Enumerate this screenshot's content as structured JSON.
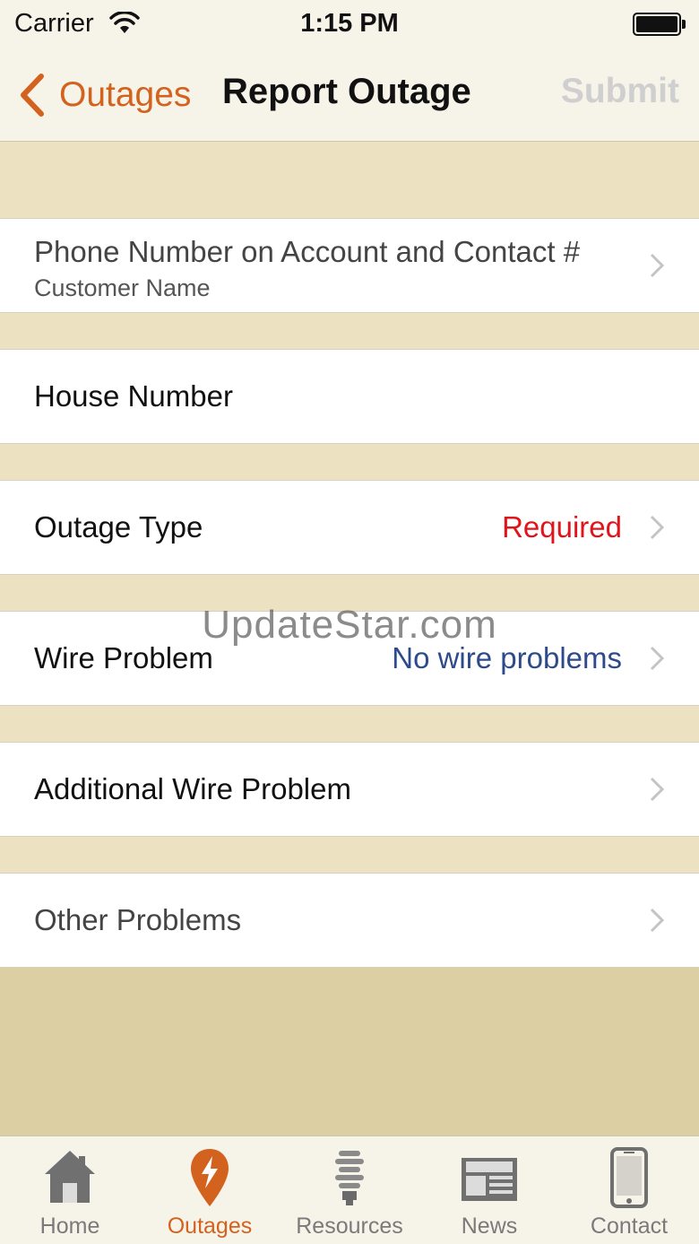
{
  "status_bar": {
    "carrier": "Carrier",
    "time": "1:15 PM"
  },
  "nav": {
    "back_label": "Outages",
    "title": "Report Outage",
    "submit_label": "Submit"
  },
  "form": {
    "phone_row": {
      "line1": "Phone Number on Account and Contact #",
      "line2": "Customer Name"
    },
    "house_row": {
      "label": "House Number"
    },
    "outage_type_row": {
      "label": "Outage Type",
      "value": "Required"
    },
    "wire_problem_row": {
      "label": "Wire Problem",
      "value": "No wire problems"
    },
    "additional_wire_row": {
      "label": "Additional Wire Problem"
    },
    "other_problems_row": {
      "label": "Other Problems"
    }
  },
  "watermark": "UpdateStar.com",
  "tabs": [
    {
      "label": "Home",
      "icon": "home-icon"
    },
    {
      "label": "Outages",
      "icon": "outage-pin-icon",
      "active": true
    },
    {
      "label": "Resources",
      "icon": "lightbulb-icon"
    },
    {
      "label": "News",
      "icon": "newspaper-icon"
    },
    {
      "label": "Contact",
      "icon": "phone-icon"
    }
  ],
  "colors": {
    "accent": "#d4621f",
    "required": "#e1141b",
    "info": "#2d4a8a",
    "background": "#dccfa3"
  }
}
